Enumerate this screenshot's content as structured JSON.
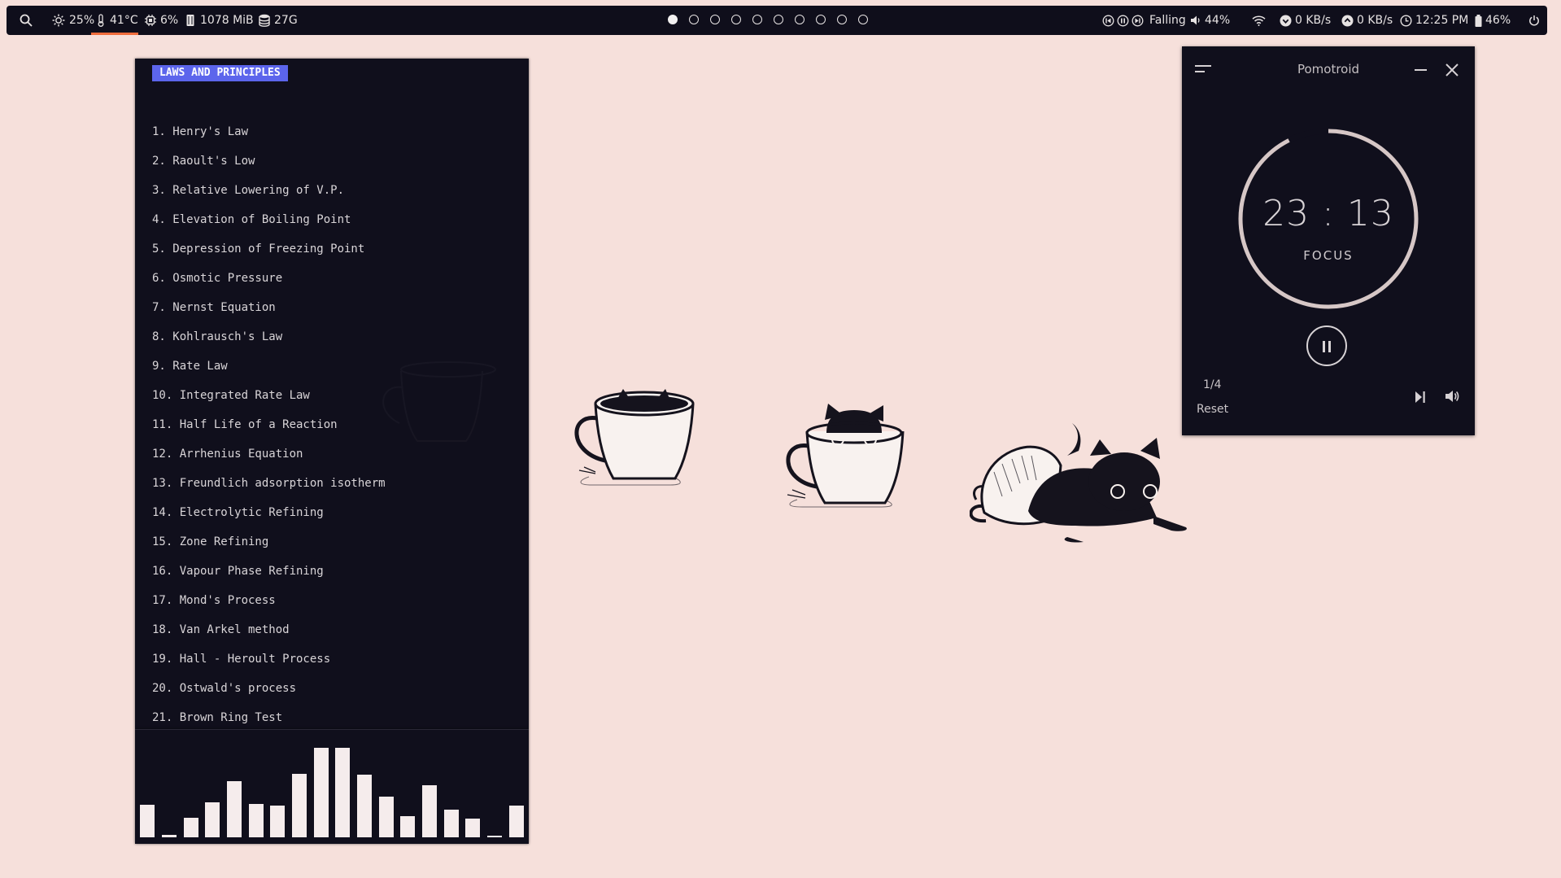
{
  "topbar": {
    "brightness": "25%",
    "temperature": "41°C",
    "cpu": "6%",
    "memory": "1078 MiB",
    "disk": "27G",
    "workspaces": [
      {
        "active": true
      },
      {
        "active": false
      },
      {
        "active": false
      },
      {
        "active": false
      },
      {
        "active": false
      },
      {
        "active": false
      },
      {
        "active": false
      },
      {
        "active": false
      },
      {
        "active": false
      },
      {
        "active": false
      }
    ],
    "media_title": "Falling",
    "volume": "44%",
    "download": "0 KB/s",
    "upload": "0 KB/s",
    "clock": "12:25 PM",
    "battery": "46%"
  },
  "laws": {
    "header": "LAWS AND PRINCIPLES",
    "items": [
      "1. Henry's Law",
      "2. Raoult's Low",
      "3. Relative Lowering of V.P.",
      "4. Elevation of Boiling Point",
      "5. Depression of Freezing Point",
      "6. Osmotic Pressure",
      "7. Nernst Equation",
      "8. Kohlrausch's Law",
      "9. Rate Law",
      "10. Integrated Rate Law",
      "11. Half Life of a Reaction",
      "12. Arrhenius Equation",
      "13. Freundlich adsorption isotherm",
      "14. Electrolytic Refining",
      "15. Zone Refining",
      "16. Vapour Phase Refining",
      "17. Mond's Process",
      "18. Van Arkel method",
      "19. Hall - Heroult Process",
      "20. Ostwald's process",
      "21. Brown Ring Test"
    ]
  },
  "visualizer": {
    "levels": [
      0.36,
      0.03,
      0.22,
      0.39,
      0.63,
      0.37,
      0.35,
      0.71,
      1.0,
      1.0,
      0.7,
      0.45,
      0.24,
      0.58,
      0.31,
      0.21,
      0.02,
      0.35
    ]
  },
  "pomotroid": {
    "title": "Pomotroid",
    "time": "23 : 13",
    "mode": "FOCUS",
    "progress": 0.074,
    "round": "1/4",
    "reset_label": "Reset"
  },
  "colors": {
    "background": "#f6e0db",
    "panel": "#100f1c",
    "accent": "#5c65ec",
    "temp_indicator": "#ef6c3c"
  }
}
